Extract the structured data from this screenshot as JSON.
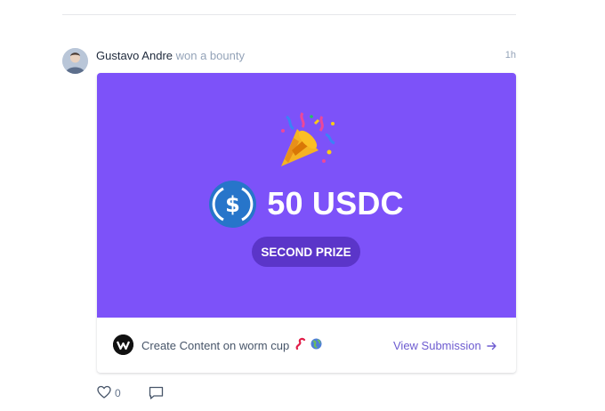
{
  "post": {
    "user_name": "Gustavo Andre",
    "action": "won a bounty",
    "time_ago": "1h"
  },
  "banner": {
    "background_color": "#7d52f9",
    "prize_amount": "50 USDC",
    "prize_label": "SECOND PRIZE",
    "token_icon": "usdc-icon",
    "celebration_icon": "party-popper-icon"
  },
  "listing": {
    "title": "Create Content on worm cup",
    "view_label": "View Submission"
  },
  "actions": {
    "like_count": "0"
  },
  "colors": {
    "accent_link": "#6d5bd0",
    "badge": "#5b35c9"
  }
}
